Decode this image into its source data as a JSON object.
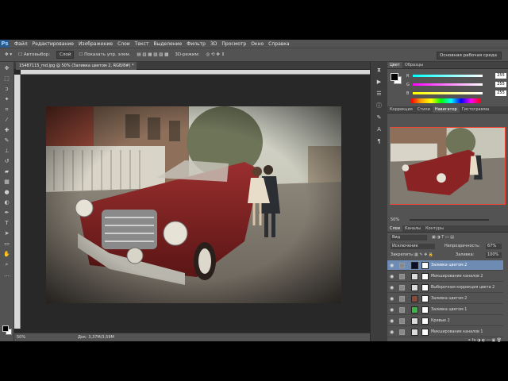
{
  "app": {
    "logo": "Ps"
  },
  "menu": [
    "Файл",
    "Редактирование",
    "Изображение",
    "Слои",
    "Текст",
    "Выделение",
    "Фильтр",
    "3D",
    "Просмотр",
    "Окно",
    "Справка"
  ],
  "options": {
    "autoselect_label": "Автовыбор:",
    "autoselect_value": "Слой",
    "transform_label": "Показать упр. элем.",
    "mode_3d": "3D-режим:",
    "workspace": "Основная рабочая среда"
  },
  "document": {
    "tab_title": "15487115_md.jpg @ 50% (Заливка цветом 2, RGB/8#) *",
    "zoom": "50%",
    "doc_info": "Док: 3,37M/3,59M"
  },
  "color_panel": {
    "tabs": [
      "Цвет",
      "Образцы"
    ],
    "r_label": "R",
    "g_label": "G",
    "b_label": "B",
    "r": "255",
    "g": "255",
    "b": "255"
  },
  "nav_panel": {
    "tabs": [
      "Коррекция",
      "Стили",
      "Навигатор",
      "Гистограмма"
    ],
    "zoom": "50%"
  },
  "layers_panel": {
    "tabs": [
      "Слои",
      "Каналы",
      "Контуры"
    ],
    "kind": "Вид",
    "blend": "Исключение",
    "opacity_label": "Непрозрачность:",
    "opacity": "67%",
    "lock_label": "Закрепить:",
    "fill_label": "Заливка:",
    "fill": "100%",
    "layers": [
      {
        "name": "Заливка цветом 2",
        "color": "#0a0e2a",
        "selected": true
      },
      {
        "name": "Микширование каналов 2",
        "color": "#dcdcdc",
        "selected": false
      },
      {
        "name": "Выборочная коррекция цвета 2",
        "color": "#dcdcdc",
        "selected": false
      },
      {
        "name": "Заливка цветом 2",
        "color": "#8a4a3a",
        "selected": false
      },
      {
        "name": "Заливка цветом 1",
        "color": "#3fb24a",
        "selected": false
      },
      {
        "name": "Кривые 2",
        "color": "#dcdcdc",
        "selected": false
      },
      {
        "name": "Микширование каналов 1",
        "color": "#dcdcdc",
        "selected": false
      }
    ]
  },
  "colors": {
    "accent": "#2a5a8c",
    "selection": "#6e8cb3"
  }
}
